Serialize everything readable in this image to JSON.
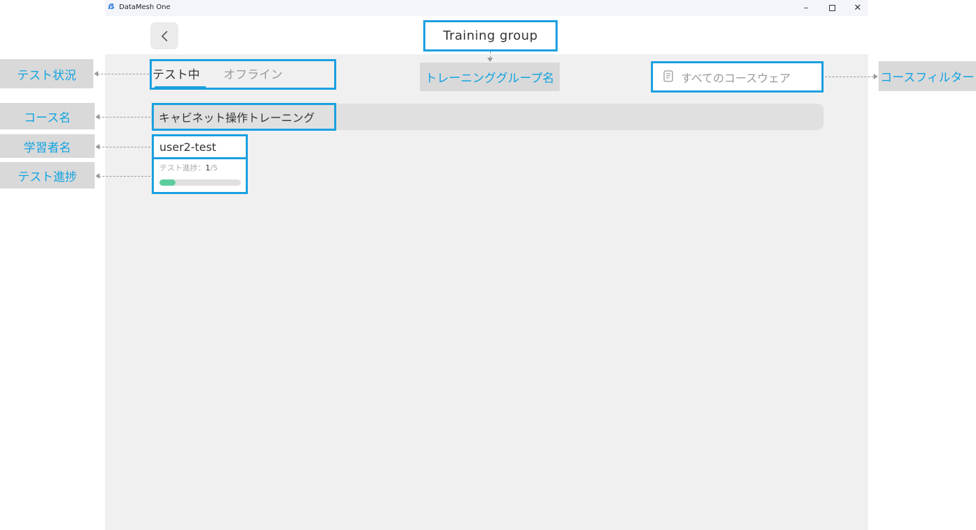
{
  "window": {
    "app_title": "DataMesh One",
    "logo_glyph": "ẞ",
    "min_glyph": "–",
    "close_glyph": "✕"
  },
  "header": {
    "group_title": "Training group"
  },
  "tabs": [
    {
      "label": "テスト中",
      "active": true
    },
    {
      "label": "オフライン",
      "active": false
    }
  ],
  "filter": {
    "label": "すべてのコースウェア",
    "icon": "document-icon"
  },
  "course": {
    "name": "キャビネット操作トレーニング"
  },
  "learner": {
    "name": "user2-test",
    "progress_label": "テスト進捗：",
    "progress_current": "1",
    "progress_total": "/5",
    "progress_fraction": 0.2,
    "progress_color": "#5dcd9d"
  },
  "annotations": {
    "test_status": "テスト状況",
    "course_name": "コース名",
    "learner_name": "学習者名",
    "test_progress": "テスト進捗",
    "group_name": "トレーニンググループ名",
    "course_filter": "コースフィルター"
  },
  "colors": {
    "accent_border": "#1aa0e0",
    "annotation_text": "#12a3e0",
    "annotation_bg": "#d9d9d9"
  }
}
